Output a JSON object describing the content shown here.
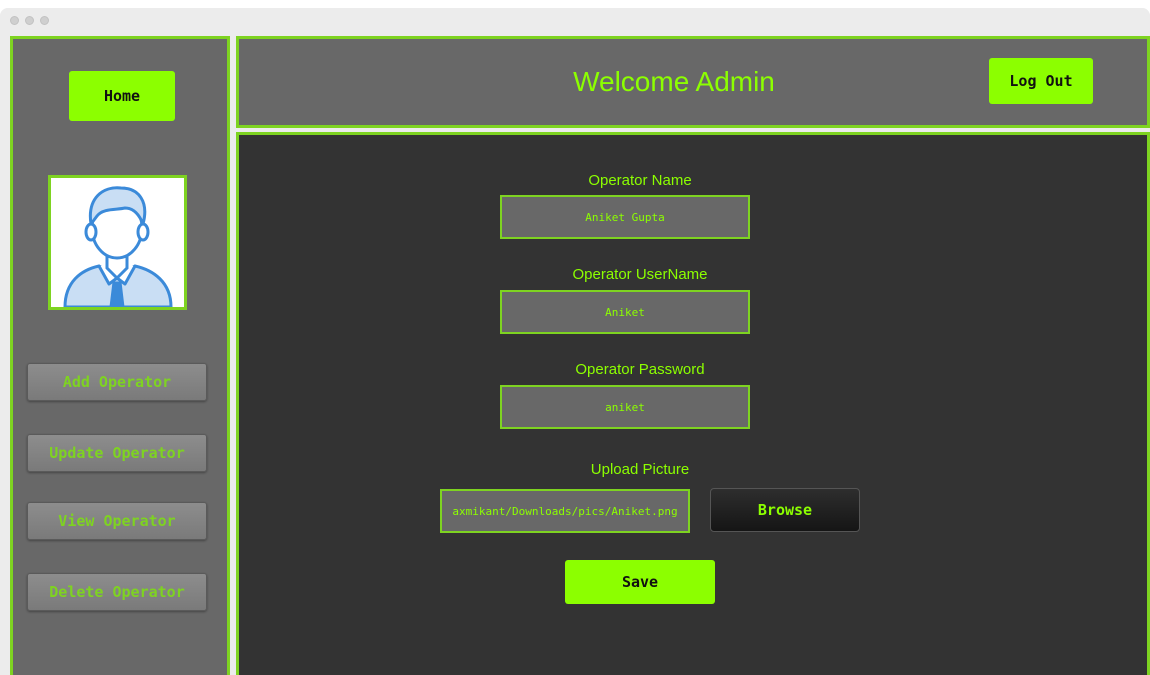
{
  "sidebar": {
    "home_label": "Home",
    "avatar_icon": "user-avatar-icon",
    "items": [
      {
        "label": "Add Operator"
      },
      {
        "label": "Update Operator"
      },
      {
        "label": "View Operator"
      },
      {
        "label": "Delete Operator"
      }
    ]
  },
  "header": {
    "title": "Welcome Admin",
    "logout_label": "Log Out"
  },
  "form": {
    "name_label": "Operator Name",
    "name_value": "Aniket Gupta",
    "username_label": "Operator UserName",
    "username_value": "Aniket",
    "password_label": "Operator Password",
    "password_value": "aniket",
    "upload_label": "Upload Picture",
    "upload_path": "axmikant/Downloads/pics/Aniket.png",
    "browse_label": "Browse",
    "save_label": "Save"
  },
  "colors": {
    "accent": "#8cff00",
    "border": "#7ed321",
    "panel": "#686868",
    "main_bg": "#333333"
  }
}
